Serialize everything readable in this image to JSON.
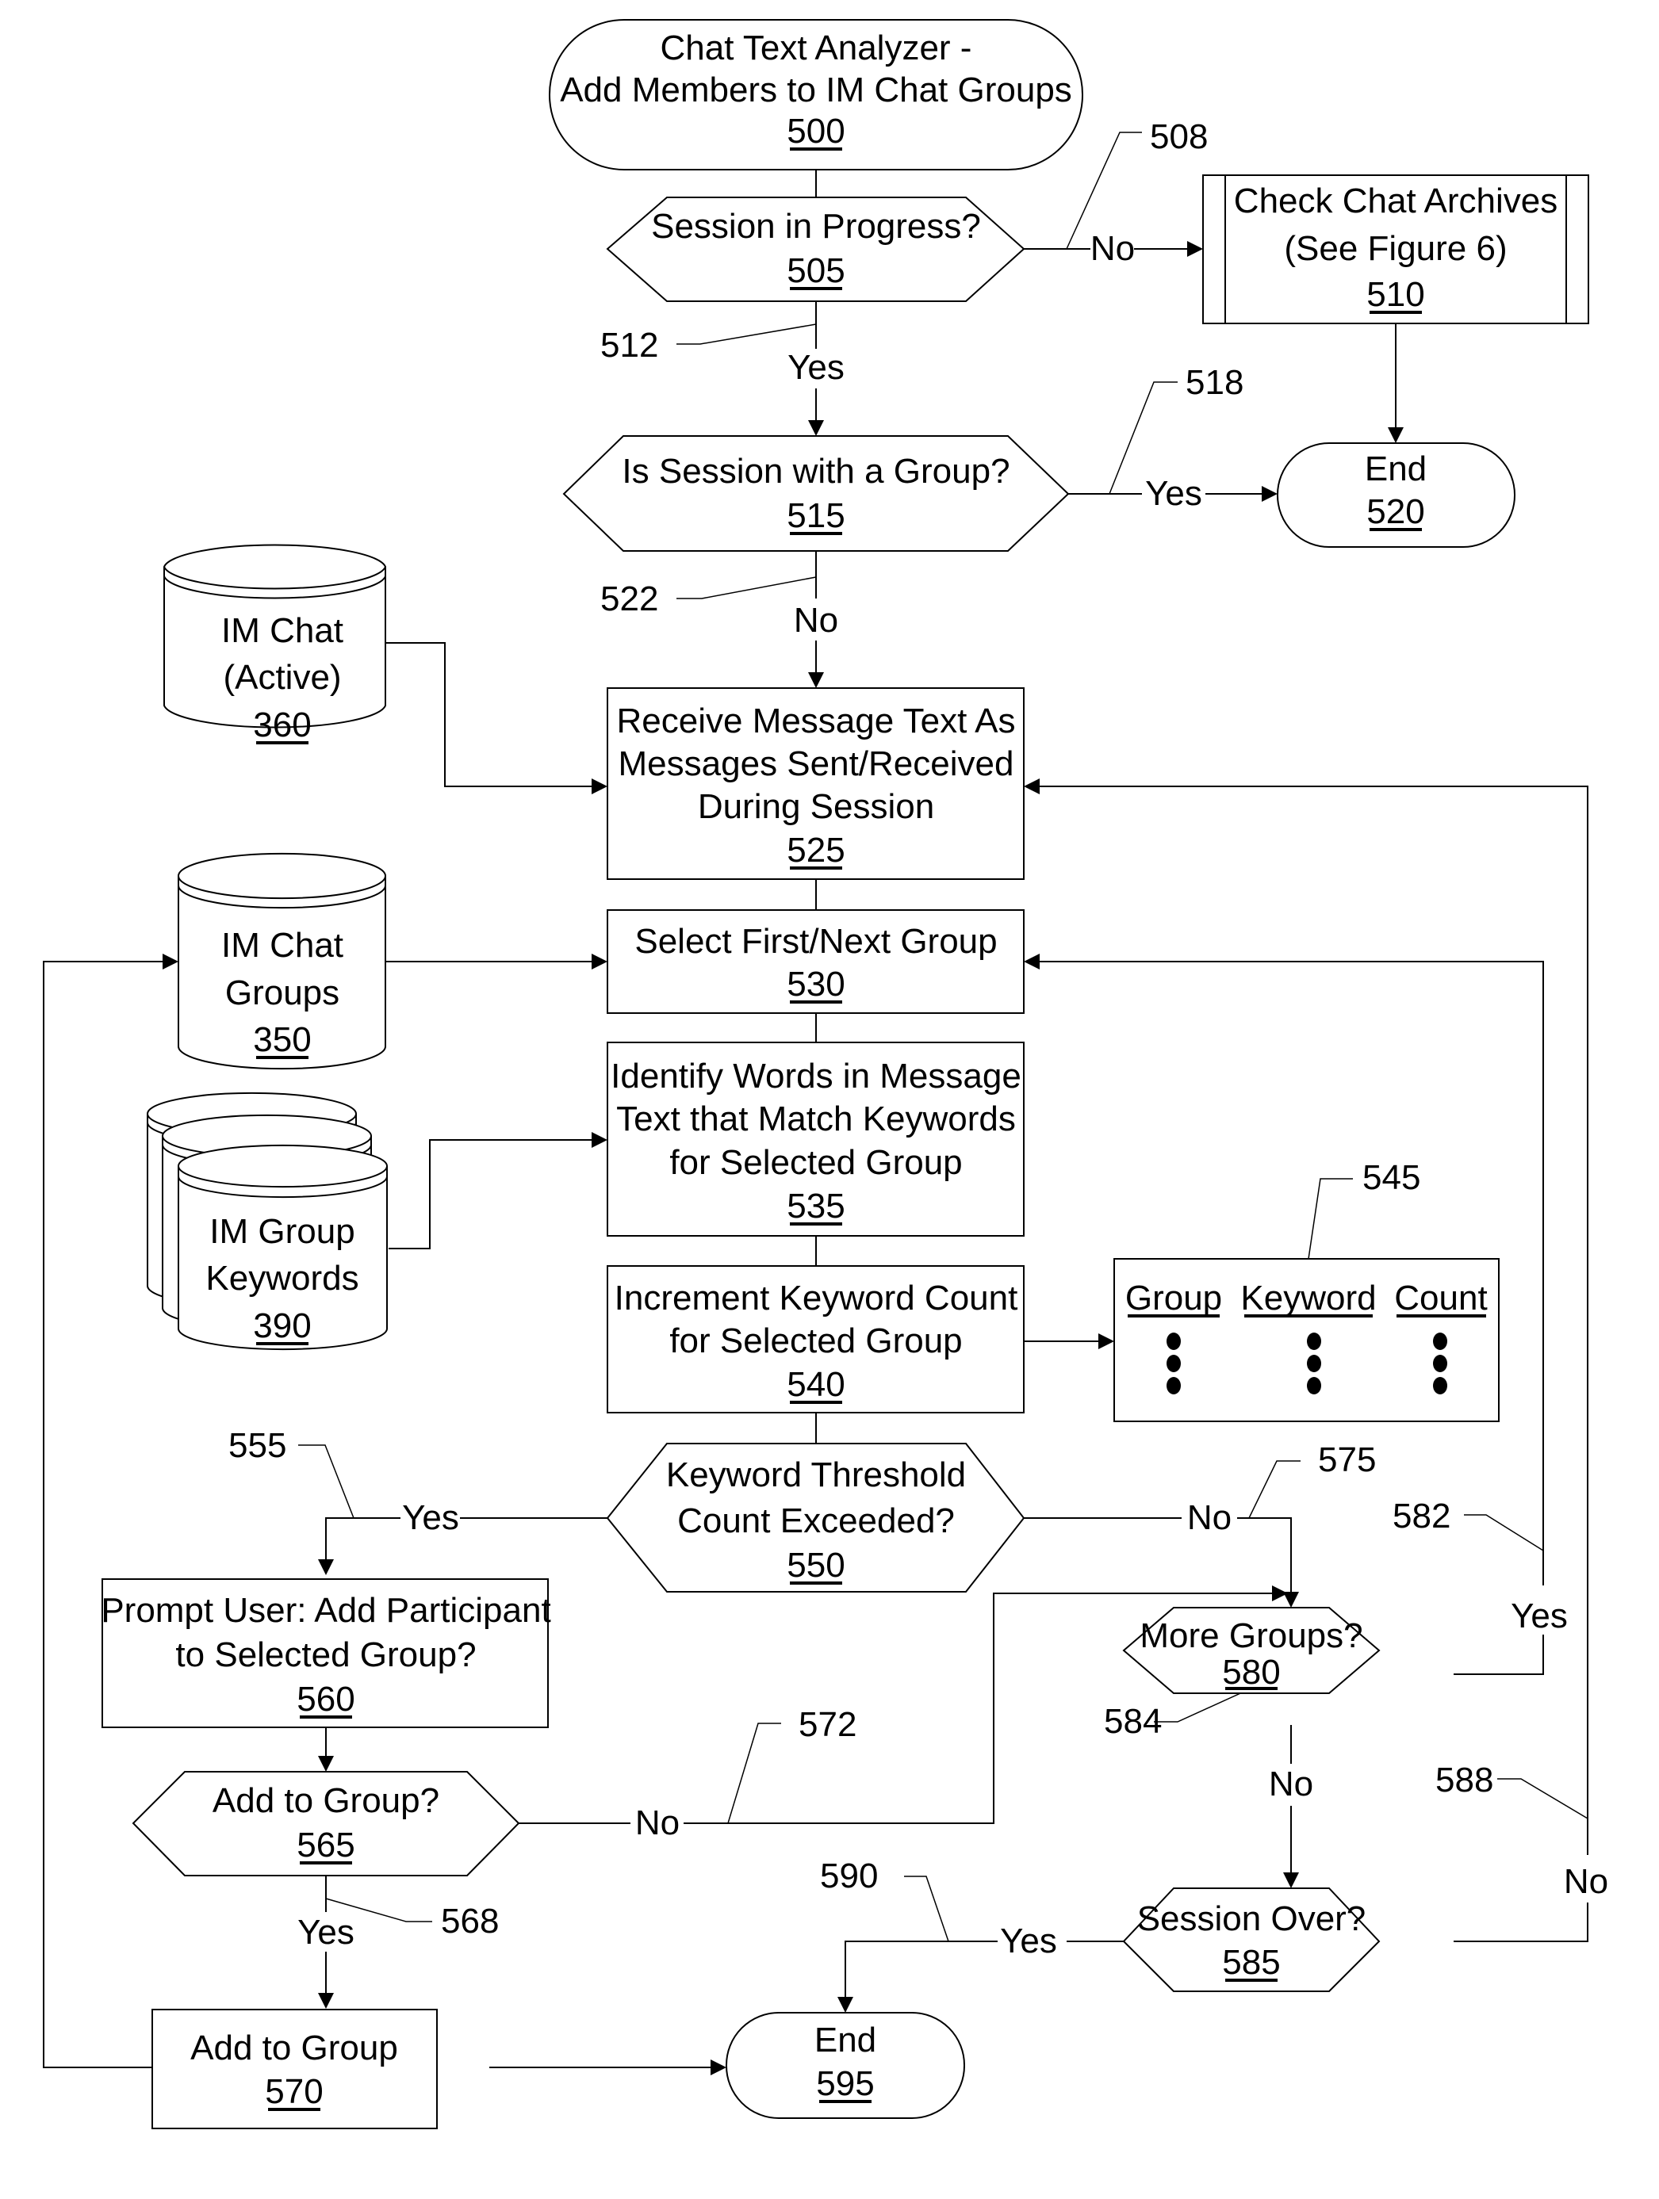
{
  "figure": {
    "title": "Chat Text Analyzer - Add Members to IM Chat Groups flowchart"
  },
  "nodes": {
    "n500": {
      "lines": [
        "Chat Text Analyzer -",
        "Add Members to IM Chat Groups"
      ],
      "ref": "500",
      "kind": "terminator"
    },
    "n505": {
      "lines": [
        "Session in Progress?"
      ],
      "ref": "505",
      "kind": "decision"
    },
    "n510": {
      "lines": [
        "Check Chat Archives",
        "(See Figure 6)"
      ],
      "ref": "510",
      "kind": "predefined-process"
    },
    "n515": {
      "lines": [
        "Is Session with a Group?"
      ],
      "ref": "515",
      "kind": "decision"
    },
    "n520": {
      "lines": [
        "End"
      ],
      "ref": "520",
      "kind": "terminator"
    },
    "n525": {
      "lines": [
        "Receive Message Text As",
        "Messages Sent/Received",
        "During Session"
      ],
      "ref": "525",
      "kind": "process"
    },
    "n530": {
      "lines": [
        "Select First/Next Group"
      ],
      "ref": "530",
      "kind": "process"
    },
    "n535": {
      "lines": [
        "Identify Words in Message",
        "Text that Match Keywords",
        "for Selected Group"
      ],
      "ref": "535",
      "kind": "process"
    },
    "n540": {
      "lines": [
        "Increment Keyword Count",
        "for Selected Group"
      ],
      "ref": "540",
      "kind": "process"
    },
    "n550": {
      "lines": [
        "Keyword Threshold",
        "Count Exceeded?"
      ],
      "ref": "550",
      "kind": "decision"
    },
    "n560": {
      "lines": [
        "Prompt User: Add Participant",
        "to Selected Group?"
      ],
      "ref": "560",
      "kind": "process"
    },
    "n565": {
      "lines": [
        "Add to Group?"
      ],
      "ref": "565",
      "kind": "decision"
    },
    "n570": {
      "lines": [
        "Add to Group"
      ],
      "ref": "570",
      "kind": "process"
    },
    "n580": {
      "lines": [
        "More Groups?"
      ],
      "ref": "580",
      "kind": "decision"
    },
    "n585": {
      "lines": [
        "Session Over?"
      ],
      "ref": "585",
      "kind": "decision"
    },
    "n595": {
      "lines": [
        "End"
      ],
      "ref": "595",
      "kind": "terminator"
    },
    "db360": {
      "lines": [
        "IM Chat",
        "(Active)"
      ],
      "ref": "360",
      "kind": "database"
    },
    "db350": {
      "lines": [
        "IM Chat",
        "Groups"
      ],
      "ref": "350",
      "kind": "database"
    },
    "db390": {
      "lines": [
        "IM Group",
        "Keywords"
      ],
      "ref": "390",
      "kind": "database-stack"
    }
  },
  "table545": {
    "headers": [
      "Group",
      "Keyword",
      "Count"
    ],
    "ellipsis": "⋮"
  },
  "edge_labels": {
    "e505_no": "No",
    "e505_yes": "Yes",
    "e515_yes": "Yes",
    "e515_no": "No",
    "e550_yes": "Yes",
    "e550_no": "No",
    "e565_no": "No",
    "e565_yes": "Yes",
    "e580_yes": "Yes",
    "e580_no": "No",
    "e585_yes": "Yes",
    "e585_no": "No"
  },
  "callouts": {
    "c508": "508",
    "c512": "512",
    "c518": "518",
    "c522": "522",
    "c545": "545",
    "c555": "555",
    "c568": "568",
    "c572": "572",
    "c575": "575",
    "c582": "582",
    "c584": "584",
    "c588": "588",
    "c590": "590"
  }
}
